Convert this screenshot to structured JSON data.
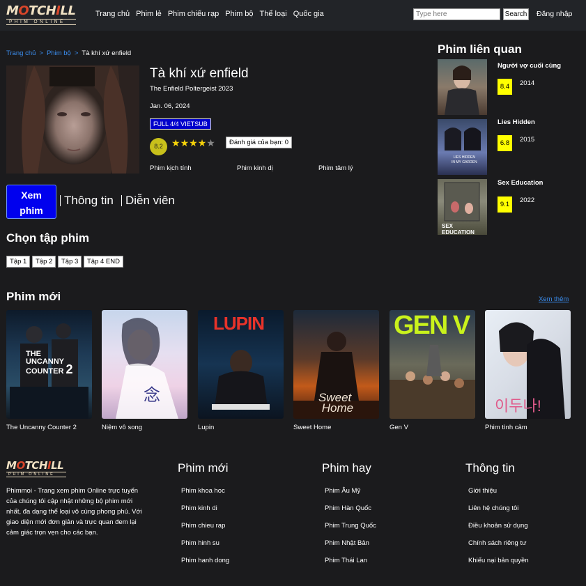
{
  "header": {
    "logo_text": "MOTCHILL",
    "logo_sub": "PHIM ONLINE",
    "nav": [
      "Trang chủ",
      "Phim lẻ",
      "Phim chiếu rạp",
      "Phim bộ",
      "Thể loại",
      "Quốc gia"
    ],
    "search_placeholder": "Type here",
    "search_button": "Search",
    "login": "Đăng nhập"
  },
  "breadcrumb": [
    "Trang chủ",
    "Phim bộ",
    "Tà khí xứ enfield"
  ],
  "breadcrumb_sep": ">",
  "movie": {
    "title": "Tà khí xứ enfield",
    "original": "The Enfield Poltergeist 2023",
    "date": "Jan. 06, 2024",
    "status": "FULL 4/4 VIETSUB",
    "score": "8.2",
    "stars_filled": 4,
    "stars_total": 5,
    "user_rating": "Đánh giá của bạn: 0",
    "genres": [
      "Phim kịch tính",
      "Phim kinh dị",
      "Phim tâm lý"
    ]
  },
  "tabs": {
    "watch_line1": "Xem",
    "watch_line2": "phim",
    "info": "Thông tin",
    "cast": "Diễn viên"
  },
  "episodes": {
    "title": "Chọn tập phim",
    "items": [
      "Tập 1",
      "Tập 2",
      "Tập 3",
      "Tập 4 END"
    ]
  },
  "new_movies": {
    "title": "Phim mới",
    "see_more": "Xem thêm",
    "items": [
      {
        "title": "The Uncanny Counter 2",
        "poster_text": "THE UNCANNY COUNTER 2"
      },
      {
        "title": "Niệm vô song",
        "poster_text": ""
      },
      {
        "title": "Lupin",
        "poster_text": "LUPIN"
      },
      {
        "title": "Sweet Home",
        "poster_text": "Sweet Home"
      },
      {
        "title": "Gen V",
        "poster_text": "GEN V"
      },
      {
        "title": "Phim tình cảm",
        "poster_text": "이두나!"
      }
    ]
  },
  "related": {
    "title": "Phim liên quan",
    "items": [
      {
        "title": "Người vợ cuối cùng",
        "score": "8.4",
        "year": "2014"
      },
      {
        "title": "Lies Hidden",
        "score": "6.8",
        "year": "2015",
        "poster_text": "LIES HIDDEN IN MY GARDEN"
      },
      {
        "title": "Sex Education",
        "score": "9.1",
        "year": "2022",
        "poster_text": "SEX EDUCATION"
      }
    ]
  },
  "footer": {
    "description": "Phimmoi - Trang xem phim Online trực tuyến của chúng tôi cập nhật những bộ phim mới nhất, đa dạng thể loại vô cùng phong phú. Với giao diện mới đơn giản và trực quan đem lại cảm giác trọn vẹn cho các bạn.",
    "columns": [
      {
        "title": "Phim mới",
        "links": [
          "Phim khoa hoc",
          "Phim kinh di",
          "Phim chieu rap",
          "Phim hinh su",
          "Phim hanh dong"
        ]
      },
      {
        "title": "Phim hay",
        "links": [
          "Phim Âu Mỹ",
          "Phim Hàn Quốc",
          "Phim Trung Quốc",
          "Phim Nhật Bản",
          "Phim Thái Lan"
        ]
      },
      {
        "title": "Thông tin",
        "links": [
          "Giới thiệu",
          "Liên hệ chúng tôi",
          "Điều khoản sử dụng",
          "Chính sách riêng tư",
          "Khiếu nại bản quyền"
        ]
      }
    ]
  },
  "colors": {
    "background": "#1b1b1d",
    "header": "#222428",
    "link": "#3b8ef0",
    "watch_button": "#0000ee",
    "score_badge": "#ffff00",
    "star": "#f5d20a"
  }
}
